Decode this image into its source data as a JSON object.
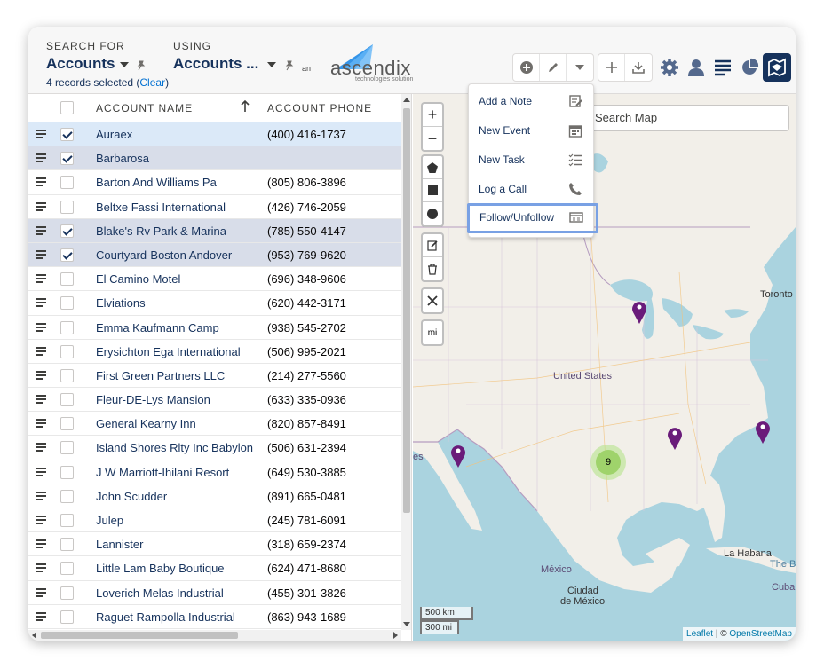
{
  "header": {
    "search_for_label": "SEARCH FOR",
    "search_for_value": "Accounts",
    "using_label": "USING",
    "using_value": "Accounts ...",
    "records_selected": "4 records selected (",
    "clear_label": "Clear",
    "close_paren": ")"
  },
  "logo": {
    "prefix": "an",
    "name": "ascendix",
    "tagline": "technologies solution"
  },
  "toolbar": {
    "icons": [
      "add-circle-icon",
      "edit-icon",
      "chevron-down-icon",
      "plus-icon",
      "download-icon",
      "gear-icon",
      "user-icon",
      "list-icon",
      "pie-chart-icon",
      "map-icon"
    ]
  },
  "dropdown": {
    "items": [
      {
        "label": "Add a Note",
        "icon": "note-icon"
      },
      {
        "label": "New Event",
        "icon": "calendar-icon"
      },
      {
        "label": "New Task",
        "icon": "task-list-icon"
      },
      {
        "label": "Log a Call",
        "icon": "phone-icon"
      },
      {
        "label": "Follow/Unfollow",
        "icon": "follow-icon",
        "highlighted": true
      }
    ]
  },
  "table": {
    "columns": [
      "ACCOUNT NAME",
      "ACCOUNT PHONE"
    ],
    "rows": [
      {
        "name": "Auraex",
        "phone": "(400) 416-1737",
        "checked": true
      },
      {
        "name": "Barbarosa",
        "phone": "",
        "checked": true
      },
      {
        "name": "Barton And Williams Pa",
        "phone": "(805) 806-3896",
        "checked": false
      },
      {
        "name": "Beltxe Fassi International",
        "phone": "(426) 746-2059",
        "checked": false
      },
      {
        "name": "Blake's Rv Park & Marina",
        "phone": "(785) 550-4147",
        "checked": true
      },
      {
        "name": "Courtyard-Boston Andover",
        "phone": "(953) 769-9620",
        "checked": true
      },
      {
        "name": "El Camino Motel",
        "phone": "(696) 348-9606",
        "checked": false
      },
      {
        "name": "Elviations",
        "phone": "(620) 442-3171",
        "checked": false
      },
      {
        "name": "Emma Kaufmann Camp",
        "phone": "(938) 545-2702",
        "checked": false
      },
      {
        "name": "Erysichton Ega International",
        "phone": "(506) 995-2021",
        "checked": false
      },
      {
        "name": "First Green Partners LLC",
        "phone": "(214) 277-5560",
        "checked": false
      },
      {
        "name": "Fleur-DE-Lys Mansion",
        "phone": "(633) 335-0936",
        "checked": false
      },
      {
        "name": "General Kearny Inn",
        "phone": "(820) 857-8491",
        "checked": false
      },
      {
        "name": "Island Shores Rlty Inc Babylon",
        "phone": "(506) 631-2394",
        "checked": false
      },
      {
        "name": "J W Marriott-Ihilani Resort",
        "phone": "(649) 530-3885",
        "checked": false
      },
      {
        "name": "John Scudder",
        "phone": "(891) 665-0481",
        "checked": false
      },
      {
        "name": "Julep",
        "phone": "(245) 781-6091",
        "checked": false
      },
      {
        "name": "Lannister",
        "phone": "(318) 659-2374",
        "checked": false
      },
      {
        "name": "Little Lam Baby Boutique",
        "phone": "(624) 471-8680",
        "checked": false
      },
      {
        "name": "Loverich Melas Industrial",
        "phone": "(455) 301-3826",
        "checked": false
      },
      {
        "name": "Raguet Rampolla Industrial",
        "phone": "(863) 943-1689",
        "checked": false
      }
    ]
  },
  "map": {
    "search_placeholder": "Search Map",
    "zoom_in": "+",
    "zoom_out": "−",
    "units_toggle": "mi",
    "scale_km": "500 km",
    "scale_mi": "300 mi",
    "attribution_leaflet": "Leaflet",
    "attribution_sep": " | © ",
    "attribution_osm": "OpenStreetMap",
    "cluster_count": "9",
    "labels": {
      "toronto": "Toronto",
      "united_states": "United States",
      "mexico": "México",
      "ciudad": "Ciudad",
      "de_mexico": "de México",
      "la_habana": "La Habana",
      "cuba": "Cuba",
      "the_b": "The B",
      "es": "es"
    },
    "marker_color": "#6a1b7a",
    "water_color": "#aad3df",
    "land_color": "#f2efe9"
  }
}
